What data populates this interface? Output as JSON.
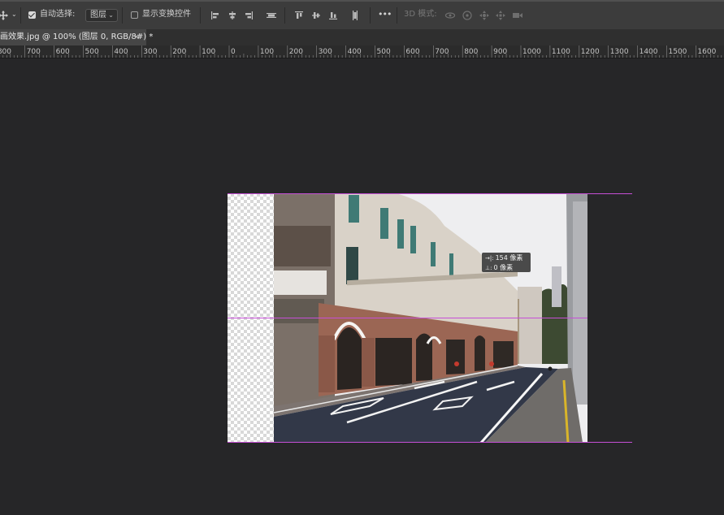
{
  "options_bar": {
    "auto_select_label": "自动选择:",
    "auto_select_checked": true,
    "layer_select_value": "图层",
    "show_transform_label": "显示变换控件",
    "show_transform_checked": false,
    "mode_3d_label": "3D 模式:",
    "more_label": "•••",
    "icons": {
      "move": "move-tool-icon",
      "align": [
        "align-left-edges-icon",
        "align-horizontal-centers-icon",
        "align-right-edges-icon",
        "distribute-horizontal-icon"
      ],
      "valign": [
        "align-top-edges-icon",
        "align-vertical-centers-icon",
        "align-bottom-edges-icon",
        "distribute-vertical-icon"
      ],
      "mode3d": [
        "orbit-3d-icon",
        "roll-3d-icon",
        "pan-3d-icon",
        "slide-3d-icon",
        "scale-3d-icon"
      ]
    }
  },
  "document_tab": {
    "title": "画效果.jpg @ 100% (图层 0, RGB/8#) *",
    "close_glyph": "×"
  },
  "ruler": {
    "labels": [
      "800",
      "700",
      "600",
      "500",
      "400",
      "300",
      "200",
      "100",
      "0",
      "100",
      "200",
      "300",
      "400",
      "500",
      "600",
      "700",
      "800",
      "900",
      "1000",
      "1100",
      "1200",
      "1300",
      "1400",
      "1500",
      "1600"
    ]
  },
  "tooltip": {
    "width_line": "154 像素",
    "height_line": "0 像素"
  },
  "colors": {
    "guide": "#c64fd6",
    "canvas_bg": "#262628",
    "toolbar_bg": "#3c3c3c"
  }
}
